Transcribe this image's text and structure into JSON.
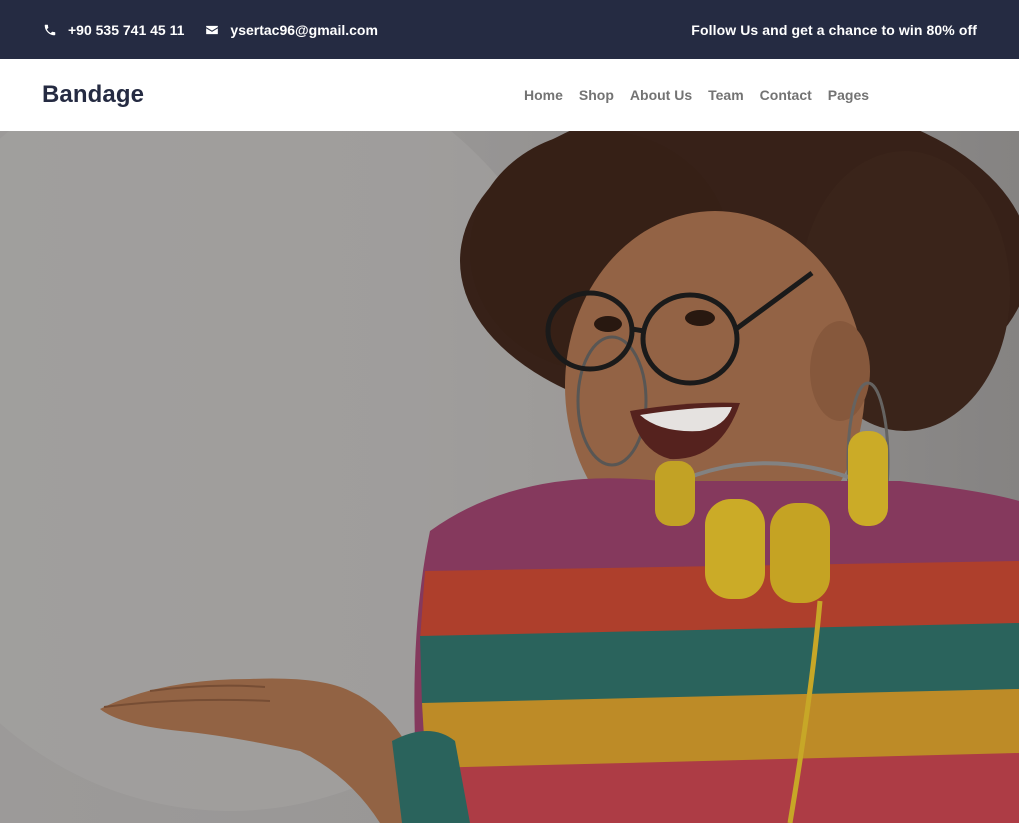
{
  "topbar": {
    "phone": "+90 535 741 45 11",
    "phone_icon": "phone-icon",
    "email": "ysertac96@gmail.com",
    "email_icon": "envelope-icon",
    "promo": "Follow Us and get a chance to win 80% off",
    "background": "#252B42"
  },
  "navbar": {
    "brand": "Bandage",
    "links": [
      "Home",
      "Shop",
      "About Us",
      "Team",
      "Contact",
      "Pages"
    ]
  },
  "colors": {
    "dark": "#252B42",
    "muted": "#737373"
  }
}
